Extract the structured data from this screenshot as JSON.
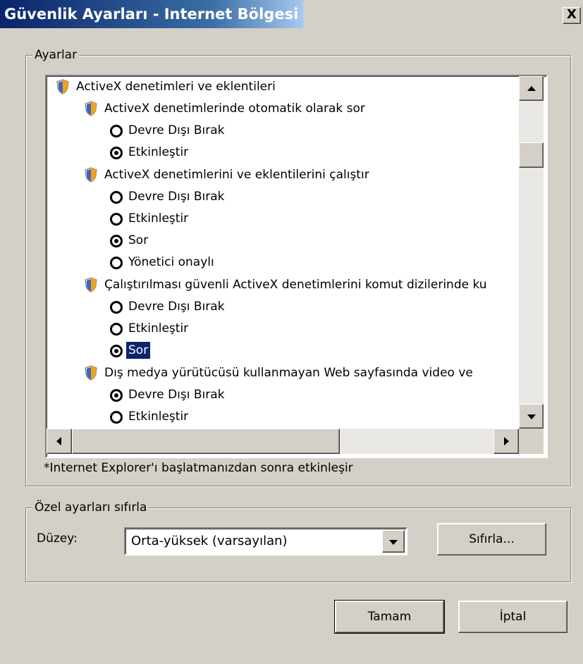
{
  "window": {
    "title": "Güvenlik Ayarları - Internet Bölgesi",
    "close_label": "X"
  },
  "settings_group": {
    "legend": "Ayarlar",
    "footnote": "*Internet Explorer'ı başlatmanızdan sonra etkinleşir"
  },
  "tree": {
    "root": "ActiveX denetimleri ve eklentileri",
    "items": [
      {
        "label": "ActiveX denetimlerinde otomatik olarak sor"
      },
      {
        "label": "Devre Dışı Bırak",
        "checked": false
      },
      {
        "label": "Etkinleştir",
        "checked": true
      },
      {
        "label": "ActiveX denetimlerini ve eklentilerini çalıştır"
      },
      {
        "label": "Devre Dışı Bırak",
        "checked": false
      },
      {
        "label": "Etkinleştir",
        "checked": false
      },
      {
        "label": "Sor",
        "checked": true
      },
      {
        "label": "Yönetici onaylı",
        "checked": false
      },
      {
        "label": "Çalıştırılması güvenli ActiveX denetimlerini komut dizilerinde ku"
      },
      {
        "label": "Devre Dışı Bırak",
        "checked": false
      },
      {
        "label": "Etkinleştir",
        "checked": false
      },
      {
        "label": "Sor",
        "checked": true,
        "selected": true
      },
      {
        "label": "Dış medya yürütücüsü kullanmayan Web sayfasında video ve"
      },
      {
        "label": "Devre Dışı Bırak",
        "checked": true
      },
      {
        "label": "Etkinleştir",
        "checked": false
      }
    ]
  },
  "reset_group": {
    "legend": "Özel ayarları sıfırla",
    "level_label": "Düzey:",
    "level_value": "Orta-yüksek (varsayılan)",
    "reset_button": "Sıfırla..."
  },
  "buttons": {
    "ok": "Tamam",
    "cancel": "İptal"
  },
  "icons": {
    "setting": "shield-icon",
    "radio": "radio-icon",
    "scroll_up": "arrow-up-icon",
    "scroll_down": "arrow-down-icon",
    "scroll_left": "arrow-left-icon",
    "scroll_right": "arrow-right-icon",
    "dropdown": "chevron-down-icon"
  }
}
